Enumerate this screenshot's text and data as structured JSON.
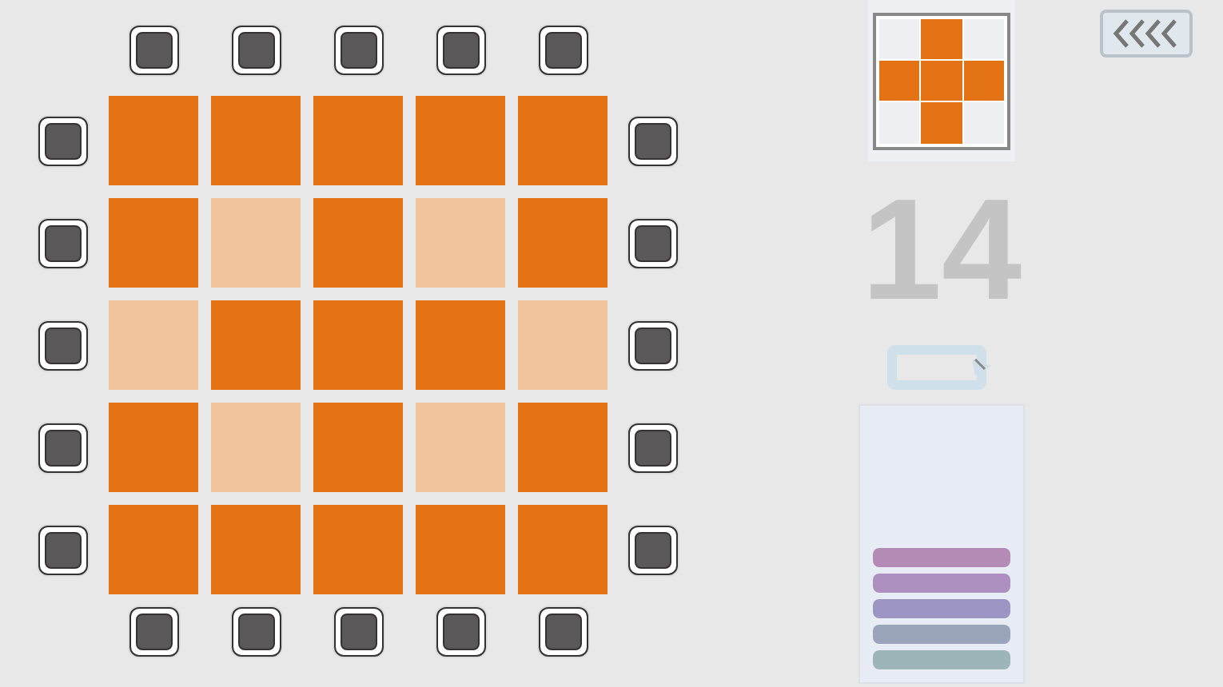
{
  "grid": [
    [
      {
        "on": true
      },
      {
        "on": true
      },
      {
        "on": true
      },
      {
        "on": true
      },
      {
        "on": true
      }
    ],
    [
      {
        "on": true
      },
      {
        "on": false
      },
      {
        "on": true
      },
      {
        "on": false
      },
      {
        "on": true
      }
    ],
    [
      {
        "on": false
      },
      {
        "on": true
      },
      {
        "on": true
      },
      {
        "on": true
      },
      {
        "on": false
      }
    ],
    [
      {
        "on": true
      },
      {
        "on": false
      },
      {
        "on": true
      },
      {
        "on": false
      },
      {
        "on": true
      }
    ],
    [
      {
        "on": true
      },
      {
        "on": true
      },
      {
        "on": true
      },
      {
        "on": true
      },
      {
        "on": true
      }
    ]
  ],
  "pattern": [
    [
      {
        "on": false
      },
      {
        "on": true
      },
      {
        "on": false
      }
    ],
    [
      {
        "on": true
      },
      {
        "on": true
      },
      {
        "on": true
      }
    ],
    [
      {
        "on": false
      },
      {
        "on": true
      },
      {
        "on": false
      }
    ]
  ],
  "moves": "14",
  "bars": [
    {
      "color": "#b48bb5"
    },
    {
      "color": "#ad8fc0"
    },
    {
      "color": "#9d95c4"
    },
    {
      "color": "#9aa4bb"
    },
    {
      "color": "#9db5b9"
    }
  ]
}
